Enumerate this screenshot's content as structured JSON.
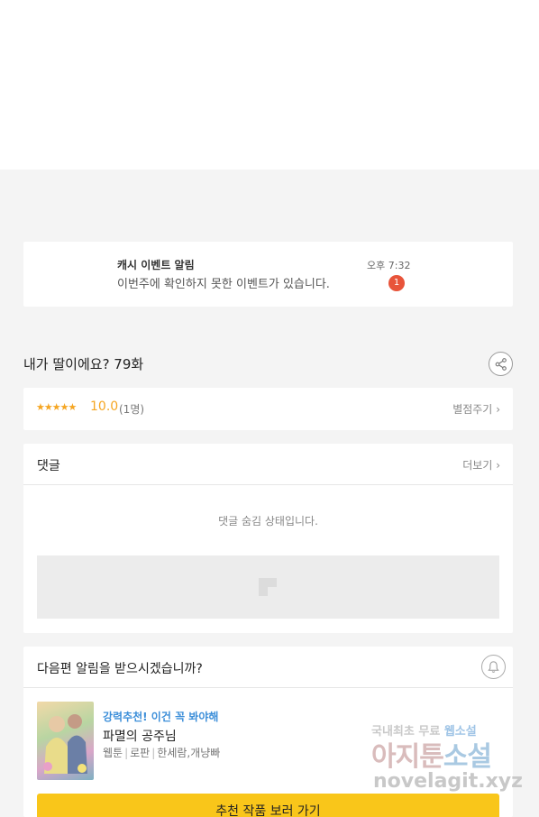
{
  "notification": {
    "title": "캐시 이벤트 알림",
    "message": "이번주에 확인하지 못한 이벤트가 있습니다.",
    "time": "오후 7:32",
    "badge": "1"
  },
  "episode": {
    "title": "내가 딸이에요? 79화",
    "share_icon": "share-icon"
  },
  "rating": {
    "stars": "★★★★★",
    "score": "10.0",
    "count": "(1명)",
    "give_label": "별점주기",
    "chevron": "›"
  },
  "comments": {
    "label": "댓글",
    "more_label": "더보기",
    "chevron": "›",
    "hidden_message": "댓글 숨김 상태입니다."
  },
  "next_episode": {
    "question": "다음편 알림을 받으시겠습니까?",
    "bell_icon": "bell-icon",
    "promo": "강력추천! 이건 꼭 봐야해",
    "work_title": "파멸의 공주님",
    "meta": [
      "웹툰",
      "로판",
      "한세람,개냥빠"
    ],
    "cta_label": "추천 작품 보러 가기"
  },
  "watermark": {
    "line1_a": "국내최초 무료 ",
    "line1_b": "웹소설",
    "line2_a": "아지툰",
    "line2_b": "소설",
    "line3": "novelagit.xyz"
  },
  "colors": {
    "accent_star": "#f5a623",
    "badge": "#e8543a",
    "promo": "#3d8fd9",
    "cta": "#f9c61a"
  }
}
